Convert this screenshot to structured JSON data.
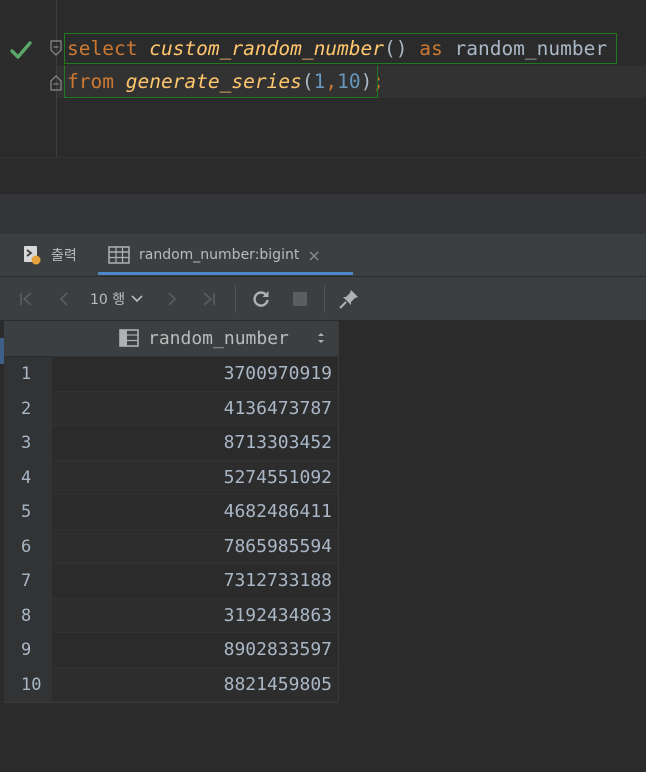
{
  "editor": {
    "line1": {
      "kw_select": "select",
      "fn_name": "custom_random_number",
      "parens": "()",
      "kw_as": "as",
      "alias": "random_number"
    },
    "line2": {
      "kw_from": "from",
      "fn_name": "generate_series",
      "open": "(",
      "arg1": "1",
      "comma": ",",
      "arg2": "10",
      "close": ")",
      "semi": ";"
    }
  },
  "tabs": {
    "output_label": "출력",
    "result_label": "random_number:bigint",
    "close_glyph": "×"
  },
  "toolbar": {
    "rows_label": "10 행"
  },
  "grid": {
    "column_header": "random_number",
    "rows": [
      {
        "num": "1",
        "value": "3700970919"
      },
      {
        "num": "2",
        "value": "4136473787"
      },
      {
        "num": "3",
        "value": "8713303452"
      },
      {
        "num": "4",
        "value": "5274551092"
      },
      {
        "num": "5",
        "value": "4682486411"
      },
      {
        "num": "6",
        "value": "7865985594"
      },
      {
        "num": "7",
        "value": "7312733188"
      },
      {
        "num": "8",
        "value": "3192434863"
      },
      {
        "num": "9",
        "value": "8902833597"
      },
      {
        "num": "10",
        "value": "8821459805"
      }
    ]
  },
  "colors": {
    "accent": "#4a88c7",
    "success": "#59a869",
    "keyword": "#cc7832",
    "function": "#ffc66d",
    "number": "#6897bb"
  }
}
